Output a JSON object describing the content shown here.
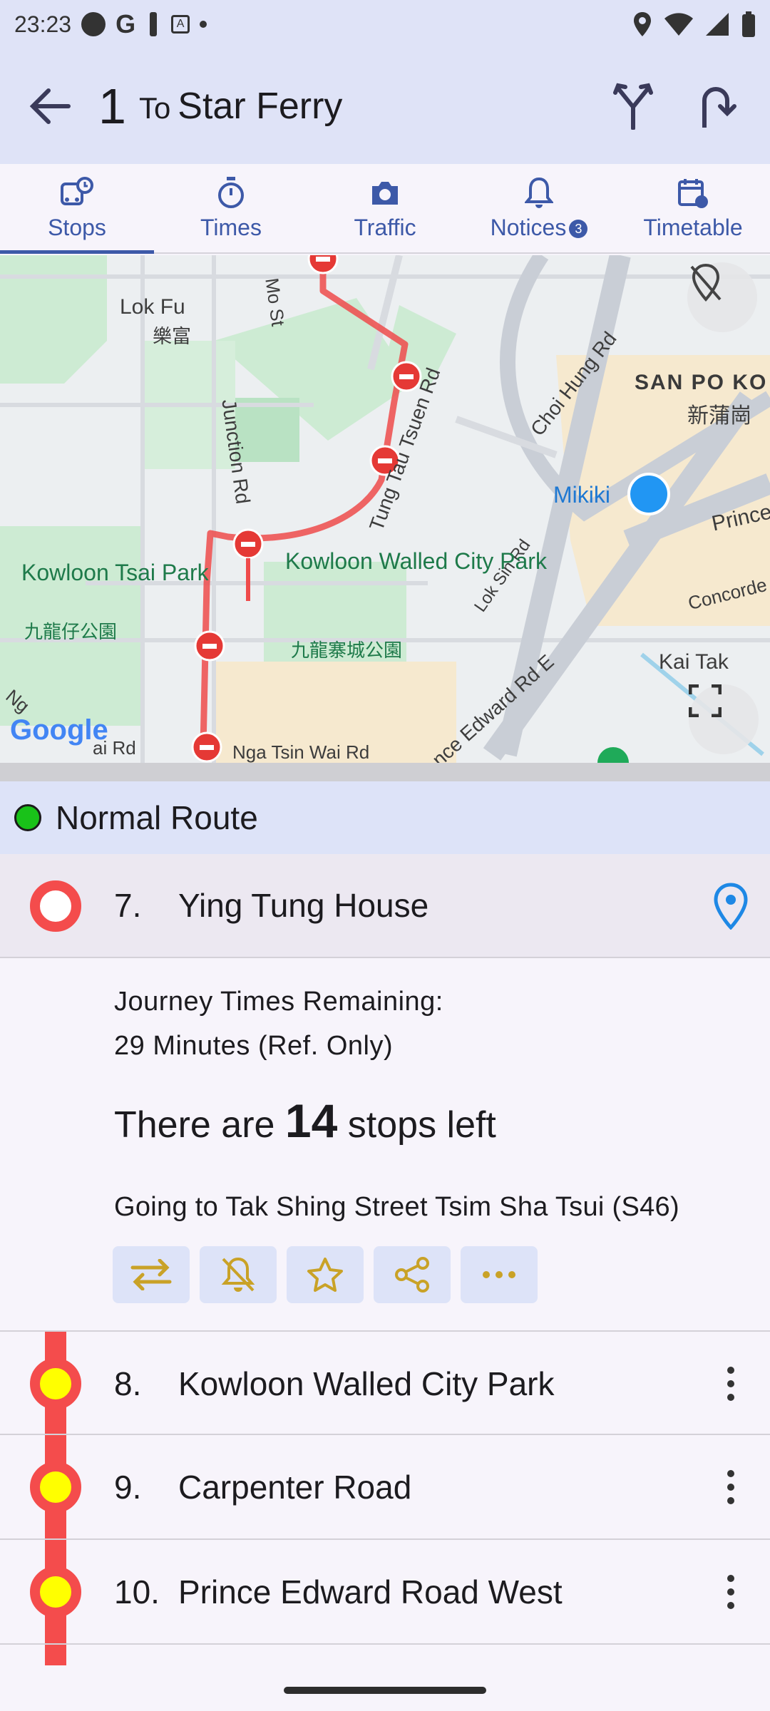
{
  "status_bar": {
    "time": "23:23",
    "g_label": "G",
    "badge_label": "A"
  },
  "app_bar": {
    "route_number": "1",
    "to_label": "To",
    "destination": "Star Ferry"
  },
  "tabs": [
    {
      "label": "Stops",
      "icon": "bus-clock-icon"
    },
    {
      "label": "Times",
      "icon": "stopwatch-icon"
    },
    {
      "label": "Traffic",
      "icon": "camera-icon"
    },
    {
      "label": "Notices",
      "icon": "bell-icon",
      "badge": "3"
    },
    {
      "label": "Timetable",
      "icon": "calendar-clock-icon"
    }
  ],
  "map": {
    "labels": {
      "lok_fu_en": "Lok Fu",
      "lok_fu_zh": "樂富",
      "mo_st": "Mo St",
      "junction_rd": "Junction Rd",
      "tung_tau_tsuen_rd": "Tung Tau Tsuen Rd",
      "choi_hung_rd": "Choi Hung Rd",
      "san_po_kong_en": "SAN PO KO",
      "san_po_kong_zh": "新蒲崗",
      "mikiki": "Mikiki",
      "prince": "Prince",
      "lok_sin_rd": "Lok Sin Rd",
      "concorde": "Concorde",
      "kowloon_tsai_park_en": "Kowloon Tsai Park",
      "kowloon_tsai_park_zh": "九龍仔公園",
      "walled_city_park_en": "Kowloon Walled City Park",
      "walled_city_park_zh": "九龍寨城公園",
      "prince_edward_rd_e": "nce Edward Rd E",
      "kai_tak": "Kai Tak",
      "nga_tsin_wai_rd": "Nga Tsin Wai Rd",
      "nga_left": "Ng",
      "ai_rd": "ai Rd",
      "google": "Google"
    }
  },
  "route_banner": {
    "label": "Normal Route"
  },
  "current_stop": {
    "number": "7.",
    "name": "Ying Tung House",
    "journey_line1": "Journey Times Remaining:",
    "journey_line2": "29 Minutes (Ref. Only)",
    "stops_left_prefix": "There are",
    "stops_left_count": "14",
    "stops_left_suffix": "stops left",
    "going_to": "Going to Tak Shing Street Tsim Sha Tsui (S46)"
  },
  "stops": [
    {
      "number": "8.",
      "name": "Kowloon Walled City Park"
    },
    {
      "number": "9.",
      "name": "Carpenter Road"
    },
    {
      "number": "10.",
      "name": "Prince Edward Road West"
    }
  ],
  "colors": {
    "route_line": "#f44c4c",
    "stop_fill": "#ffff00",
    "accent": "#3d59a8",
    "action_icon": "#c9a227",
    "normal_route_dot": "#19c219"
  }
}
